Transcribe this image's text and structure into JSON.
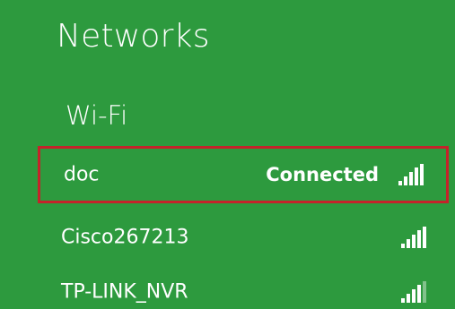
{
  "header": {
    "title": "Networks"
  },
  "wifi": {
    "section_label": "Wi-Fi",
    "networks": [
      {
        "name": "doc",
        "status": "Connected",
        "signal_bars": 5,
        "selected": true
      },
      {
        "name": "Cisco267213",
        "status": "",
        "signal_bars": 5,
        "selected": false
      },
      {
        "name": "TP-LINK_NVR",
        "status": "",
        "signal_bars": 4,
        "selected": false
      }
    ]
  },
  "colors": {
    "background": "#2d9a3e",
    "text": "#ffffff",
    "selection_border": "#c4232a"
  },
  "icons": {
    "signal": "wifi-signal-icon"
  }
}
